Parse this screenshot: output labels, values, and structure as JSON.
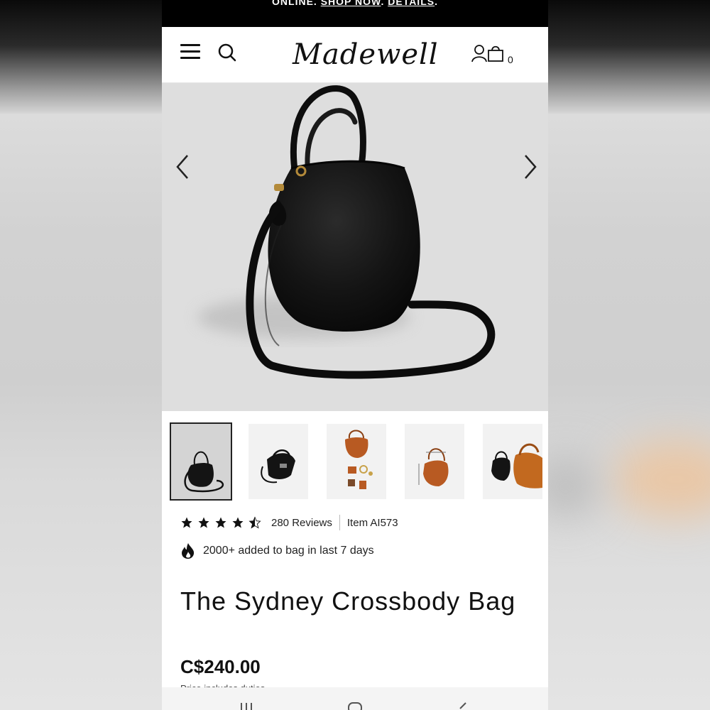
{
  "promo": {
    "text_start": "ONLINE. ",
    "link_shop": "SHOP NOW",
    "sep": ". ",
    "link_details": "DETAILS",
    "text_end": "."
  },
  "header": {
    "logo": "Madewell",
    "bag_count": "0"
  },
  "product": {
    "rating": 4.5,
    "reviews": "280 Reviews",
    "item": "Item AI573",
    "social_proof": "2000+ added to bag in last 7 days",
    "title": "The Sydney Crossbody Bag",
    "price": "C$240.00",
    "tax_note": "Price includes duties"
  },
  "icons": [
    "menu-icon",
    "search-icon",
    "account-icon",
    "bag-icon",
    "chevron-left-icon",
    "chevron-right-icon",
    "star-icon",
    "flame-icon",
    "recents-icon",
    "home-icon",
    "back-icon"
  ],
  "colors": {
    "promo_bg": "#000000",
    "hero_bg": "#dedede",
    "bag_black": "#121212",
    "bag_cognac": "#b85a22"
  }
}
